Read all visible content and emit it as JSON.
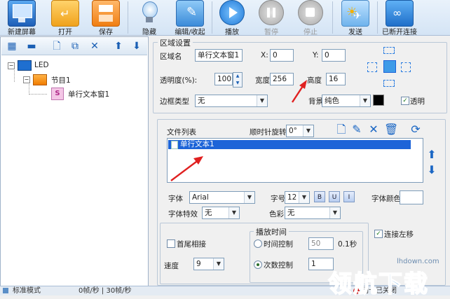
{
  "toolbar": {
    "new_screen": "新建屏幕",
    "open": "打开",
    "save": "保存",
    "hide": "隐藏",
    "edit_collapse": "编辑/收起",
    "play": "播放",
    "pause": "暂停",
    "stop": "停止",
    "send": "发送",
    "disconnected": "已断开连接"
  },
  "tree": {
    "root": "LED",
    "program": "节目1",
    "window": "单行文本窗1"
  },
  "region": {
    "title": "区域设置",
    "name_label": "区域名",
    "name_value": "单行文本窗1",
    "x_label": "X:",
    "x_value": "0",
    "y_label": "Y:",
    "y_value": "0",
    "opacity_label": "透明度(%):",
    "opacity_value": "100",
    "width_label": "宽度",
    "width_value": "256",
    "height_label": "高度",
    "height_value": "16",
    "border_label": "边框类型",
    "border_value": "无",
    "bg_label": "背景",
    "bg_value": "纯色",
    "transparent_label": "透明"
  },
  "files": {
    "list_label": "文件列表",
    "rotate_label": "顺时针旋转",
    "rotate_value": "0°",
    "items": [
      "单行文本1"
    ]
  },
  "font": {
    "font_label": "字体",
    "font_value": "Arial",
    "size_label": "字号",
    "size_value": "12",
    "bold": "B",
    "underline": "U",
    "italic": "I",
    "color_label": "字体颜色",
    "effect_label": "字体特效",
    "effect_value": "无",
    "colorize_label": "色彩",
    "colorize_value": "无"
  },
  "play": {
    "head_tail_label": "首尾相接",
    "speed_label": "速度",
    "speed_value": "9",
    "time_group": "播放时间",
    "time_control_label": "时间控制",
    "time_value": "50",
    "time_unit": "0.1秒",
    "count_control_label": "次数控制",
    "count_value": "1",
    "continuous_left_label": "连接左移"
  },
  "status": {
    "mode": "标准模式",
    "fps": "0帧/秒 | 30帧/秒",
    "net": "网卡已关闭"
  },
  "watermark": {
    "site": "lhdown.com",
    "brand": "领航下载"
  },
  "colors": {
    "accent_blue": "#2b7de0",
    "arrow_red": "#e02020",
    "selection_blue": "#1d64d8"
  }
}
